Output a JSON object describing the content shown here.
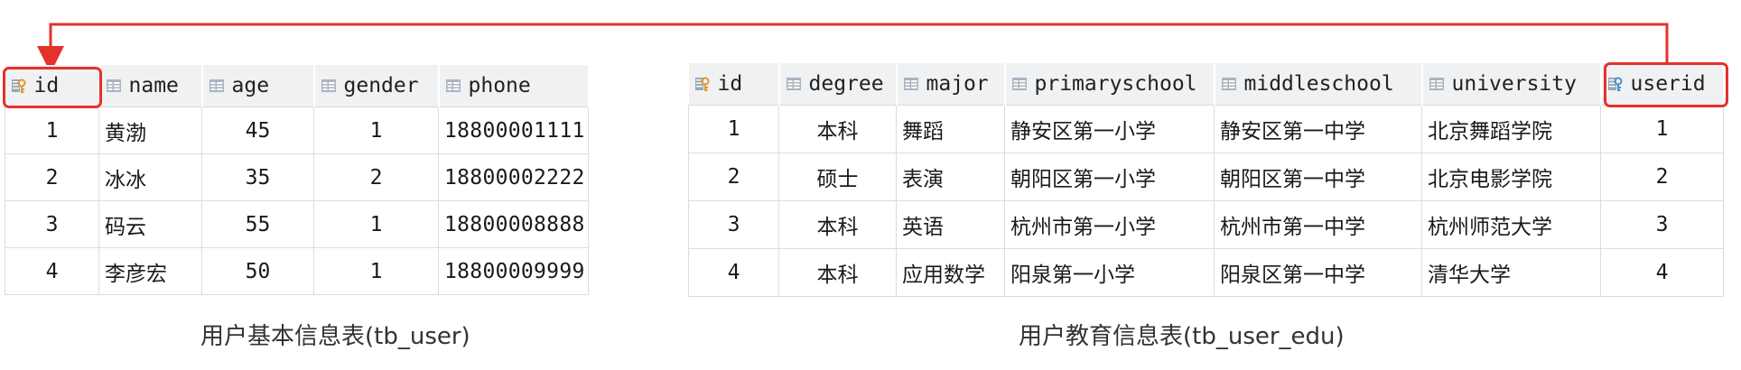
{
  "user_table": {
    "columns": [
      {
        "label": "id",
        "icon": "primary-key-icon"
      },
      {
        "label": "name",
        "icon": "column-icon"
      },
      {
        "label": "age",
        "icon": "column-icon"
      },
      {
        "label": "gender",
        "icon": "column-icon"
      },
      {
        "label": "phone",
        "icon": "column-icon"
      }
    ],
    "rows": [
      [
        "1",
        "黄渤",
        "45",
        "1",
        "18800001111"
      ],
      [
        "2",
        "冰冰",
        "35",
        "2",
        "18800002222"
      ],
      [
        "3",
        "码云",
        "55",
        "1",
        "18800008888"
      ],
      [
        "4",
        "李彦宏",
        "50",
        "1",
        "18800009999"
      ]
    ],
    "caption": "用户基本信息表(tb_user)"
  },
  "edu_table": {
    "columns": [
      {
        "label": "id",
        "icon": "primary-key-icon"
      },
      {
        "label": "degree",
        "icon": "column-icon"
      },
      {
        "label": "major",
        "icon": "column-icon"
      },
      {
        "label": "primaryschool",
        "icon": "column-icon"
      },
      {
        "label": "middleschool",
        "icon": "column-icon"
      },
      {
        "label": "university",
        "icon": "column-icon"
      },
      {
        "label": "userid",
        "icon": "foreign-key-icon"
      }
    ],
    "rows": [
      [
        "1",
        "本科",
        "舞蹈",
        "静安区第一小学",
        "静安区第一中学",
        "北京舞蹈学院",
        "1"
      ],
      [
        "2",
        "硕士",
        "表演",
        "朝阳区第一小学",
        "朝阳区第一中学",
        "北京电影学院",
        "2"
      ],
      [
        "3",
        "本科",
        "英语",
        "杭州市第一小学",
        "杭州市第一中学",
        "杭州师范大学",
        "3"
      ],
      [
        "4",
        "本科",
        "应用数学",
        "阳泉第一小学",
        "阳泉区第一中学",
        "清华大学",
        "4"
      ]
    ],
    "caption": "用户教育信息表(tb_user_edu)"
  },
  "colors": {
    "highlight": "#e5312b",
    "key_gold": "#d99a2b",
    "key_blue": "#4a90c8",
    "header_bg": "#f0f1f3"
  }
}
